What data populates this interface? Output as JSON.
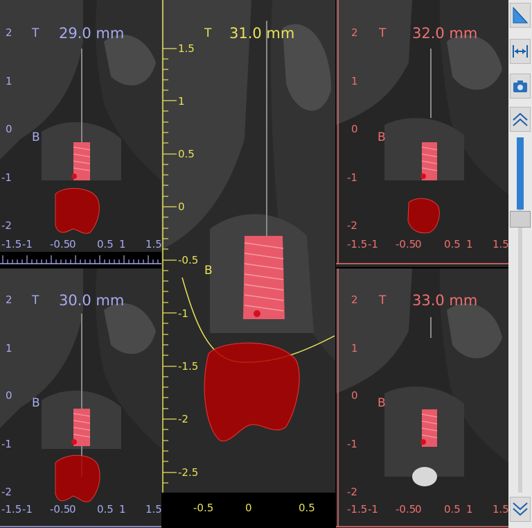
{
  "panels": {
    "p29": {
      "distance": "29.0 mm",
      "top": "T",
      "bottom": "B",
      "yticks": [
        "2",
        "1",
        "0",
        "-1",
        "-2"
      ],
      "xticks": [
        "-1.5",
        "-1",
        "-0.5",
        "0",
        "0.5",
        "1",
        "1.5"
      ]
    },
    "p30": {
      "distance": "30.0 mm",
      "top": "T",
      "bottom": "B",
      "yticks": [
        "2",
        "1",
        "0",
        "-1",
        "-2"
      ],
      "xticks": [
        "-1.5",
        "-1",
        "-0.5",
        "0",
        "0.5",
        "1",
        "1.5"
      ]
    },
    "p31": {
      "distance": "31.0 mm",
      "top": "T",
      "bottom": "B",
      "yticks": [
        "1.5",
        "1",
        "0.5",
        "0",
        "-0.5",
        "-1",
        "-1.5",
        "-2",
        "-2.5"
      ],
      "xticks": [
        "-0.5",
        "0",
        "0.5"
      ]
    },
    "p32": {
      "distance": "32.0 mm",
      "top": "T",
      "bottom": "B",
      "yticks": [
        "2",
        "1",
        "0",
        "-1",
        "-2"
      ],
      "xticks": [
        "-1.5",
        "-1",
        "-0.5",
        "0",
        "0.5",
        "1",
        "1.5"
      ]
    },
    "p33": {
      "distance": "33.0 mm",
      "top": "T",
      "bottom": "B",
      "yticks": [
        "2",
        "1",
        "0",
        "-1",
        "-2"
      ],
      "xticks": [
        "-1.5",
        "-1",
        "-0.5",
        "0",
        "0.5",
        "1",
        "1.5"
      ]
    }
  },
  "colors": {
    "blue": "#a8aaf0",
    "yellow": "#e8e25a",
    "red": "#f07070",
    "implant": "#f06070",
    "nerve": "#c00000"
  },
  "toolbar": {
    "icons": [
      "measure-triangle-icon",
      "width-measure-icon",
      "camera-icon",
      "scroll-up-icon",
      "scroll-down-icon"
    ],
    "scroll_position": 0.83
  }
}
